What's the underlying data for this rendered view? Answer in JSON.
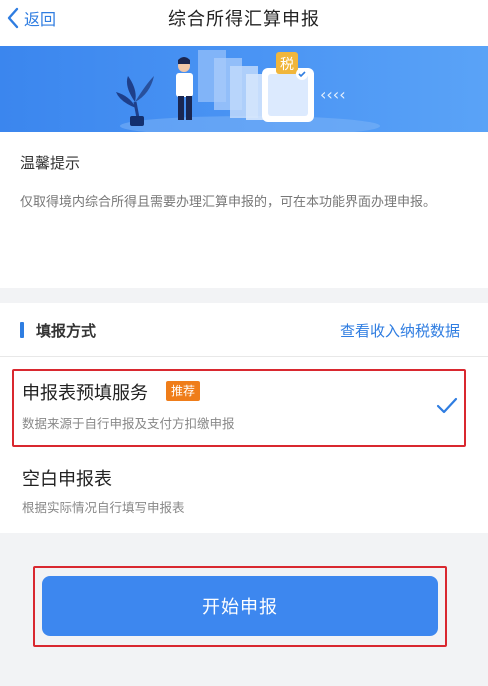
{
  "navbar": {
    "back_label": "返回",
    "title": "综合所得汇算申报"
  },
  "banner": {
    "tax_sign": "税",
    "chevrons": "‹‹‹‹"
  },
  "tip": {
    "title": "温馨提示",
    "body": "仅取得境内综合所得且需要办理汇算申报的，可在本功能界面办理申报。"
  },
  "filing": {
    "section_title": "填报方式",
    "view_income_link": "查看收入纳税数据",
    "options": [
      {
        "title": "申报表预填服务",
        "badge": "推荐",
        "subtitle": "数据来源于自行申报及支付方扣缴申报",
        "selected": true
      },
      {
        "title": "空白申报表",
        "subtitle": "根据实际情况自行填写申报表",
        "selected": false
      }
    ]
  },
  "submit": {
    "label": "开始申报"
  },
  "colors": {
    "accent": "#2f7de1",
    "button": "#3d87ef",
    "badge": "#ef7d1a",
    "highlight": "#d9282f"
  }
}
